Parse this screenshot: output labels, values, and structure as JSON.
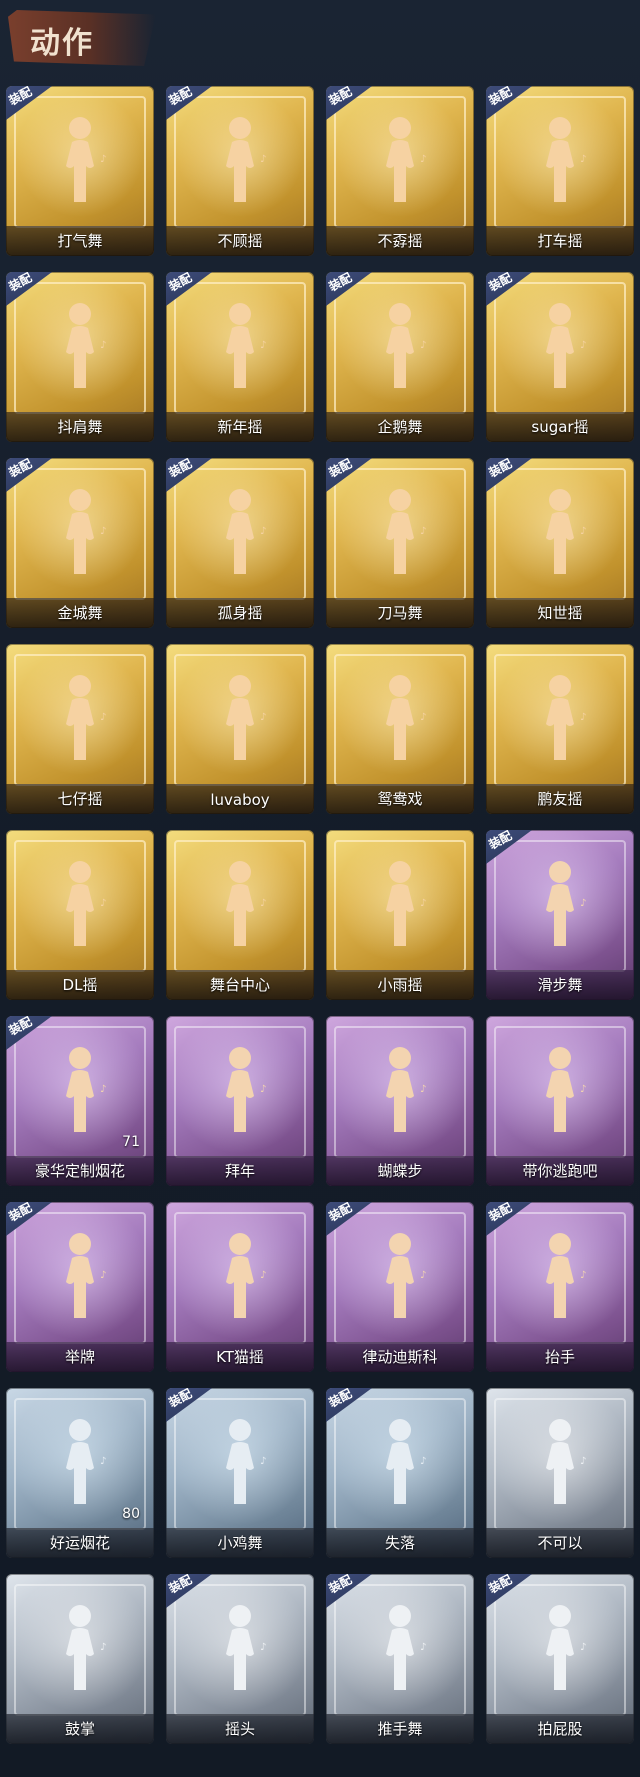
{
  "header": {
    "title": "动作"
  },
  "equip_label": "装配",
  "items": [
    {
      "name": "打气舞",
      "rarity": "gold",
      "equipped": true,
      "count": ""
    },
    {
      "name": "不顾摇",
      "rarity": "gold",
      "equipped": true,
      "count": ""
    },
    {
      "name": "不孬摇",
      "rarity": "gold",
      "equipped": true,
      "count": ""
    },
    {
      "name": "打车摇",
      "rarity": "gold",
      "equipped": true,
      "count": ""
    },
    {
      "name": "抖肩舞",
      "rarity": "gold",
      "equipped": true,
      "count": ""
    },
    {
      "name": "新年摇",
      "rarity": "gold",
      "equipped": true,
      "count": ""
    },
    {
      "name": "企鹅舞",
      "rarity": "gold",
      "equipped": true,
      "count": ""
    },
    {
      "name": "sugar摇",
      "rarity": "gold",
      "equipped": true,
      "count": ""
    },
    {
      "name": "金城舞",
      "rarity": "gold",
      "equipped": true,
      "count": ""
    },
    {
      "name": "孤身摇",
      "rarity": "gold",
      "equipped": true,
      "count": ""
    },
    {
      "name": "刀马舞",
      "rarity": "gold",
      "equipped": true,
      "count": ""
    },
    {
      "name": "知世摇",
      "rarity": "gold",
      "equipped": true,
      "count": ""
    },
    {
      "name": "七仔摇",
      "rarity": "gold",
      "equipped": false,
      "count": ""
    },
    {
      "name": "luvaboy",
      "rarity": "gold",
      "equipped": false,
      "count": ""
    },
    {
      "name": "鸳鸯戏",
      "rarity": "gold",
      "equipped": false,
      "count": ""
    },
    {
      "name": "鹏友摇",
      "rarity": "gold",
      "equipped": false,
      "count": ""
    },
    {
      "name": "DL摇",
      "rarity": "gold",
      "equipped": false,
      "count": ""
    },
    {
      "name": "舞台中心",
      "rarity": "gold",
      "equipped": false,
      "count": ""
    },
    {
      "name": "小雨摇",
      "rarity": "gold",
      "equipped": false,
      "count": ""
    },
    {
      "name": "滑步舞",
      "rarity": "purple",
      "equipped": true,
      "count": ""
    },
    {
      "name": "豪华定制烟花",
      "rarity": "purple",
      "equipped": true,
      "count": "71"
    },
    {
      "name": "拜年",
      "rarity": "purple",
      "equipped": false,
      "count": ""
    },
    {
      "name": "蝴蝶步",
      "rarity": "purple",
      "equipped": false,
      "count": ""
    },
    {
      "name": "带你逃跑吧",
      "rarity": "purple",
      "equipped": false,
      "count": ""
    },
    {
      "name": "举牌",
      "rarity": "purple",
      "equipped": true,
      "count": ""
    },
    {
      "name": "KT猫摇",
      "rarity": "purple",
      "equipped": false,
      "count": ""
    },
    {
      "name": "律动迪斯科",
      "rarity": "purple",
      "equipped": true,
      "count": ""
    },
    {
      "name": "抬手",
      "rarity": "purple",
      "equipped": true,
      "count": ""
    },
    {
      "name": "好运烟花",
      "rarity": "blue",
      "equipped": false,
      "count": "80"
    },
    {
      "name": "小鸡舞",
      "rarity": "blue",
      "equipped": true,
      "count": ""
    },
    {
      "name": "失落",
      "rarity": "blue",
      "equipped": true,
      "count": ""
    },
    {
      "name": "不可以",
      "rarity": "silver",
      "equipped": false,
      "count": ""
    },
    {
      "name": "鼓掌",
      "rarity": "silver",
      "equipped": false,
      "count": ""
    },
    {
      "name": "摇头",
      "rarity": "silver",
      "equipped": true,
      "count": ""
    },
    {
      "name": "推手舞",
      "rarity": "silver",
      "equipped": true,
      "count": ""
    },
    {
      "name": "拍屁股",
      "rarity": "silver",
      "equipped": true,
      "count": ""
    }
  ]
}
